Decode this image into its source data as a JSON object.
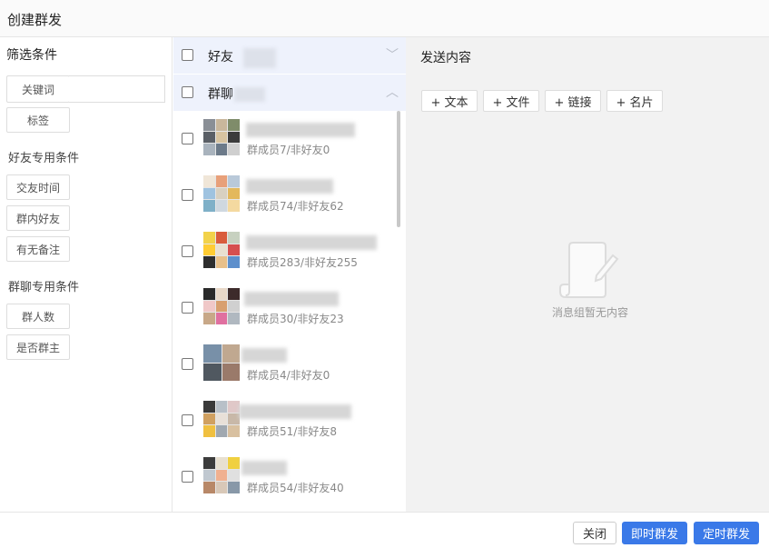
{
  "window": {
    "title": "创建群发"
  },
  "filters": {
    "heading": "筛选条件",
    "keyword_button": "关键词",
    "tag_button": "标签",
    "friend_section": "好友专用条件",
    "friend_buttons": [
      "交友时间",
      "群内好友",
      "有无备注"
    ],
    "group_section": "群聊专用条件",
    "group_buttons": [
      "群人数",
      "是否群主"
    ]
  },
  "list": {
    "friends_header": "好友",
    "groups_header": "群聊",
    "chevron_collapsed": "﹀",
    "chevron_expanded": "︿",
    "groups": [
      {
        "meta": "群成员7/非好友0"
      },
      {
        "meta": "群成员74/非好友62"
      },
      {
        "meta": "群成员283/非好友255"
      },
      {
        "meta": "群成员30/非好友23"
      },
      {
        "meta": "群成员4/非好友0"
      },
      {
        "meta": "群成员51/非好友8"
      },
      {
        "meta": "群成员54/非好友40"
      }
    ]
  },
  "content": {
    "heading": "发送内容",
    "add_buttons": [
      "+ 文本",
      "+ 文件",
      "+ 链接",
      "+ 名片"
    ],
    "empty_text": "消息组暂无内容"
  },
  "footer": {
    "close_label": "关闭",
    "send_now_label": "即时群发",
    "scheduled_label": "定时群发"
  }
}
